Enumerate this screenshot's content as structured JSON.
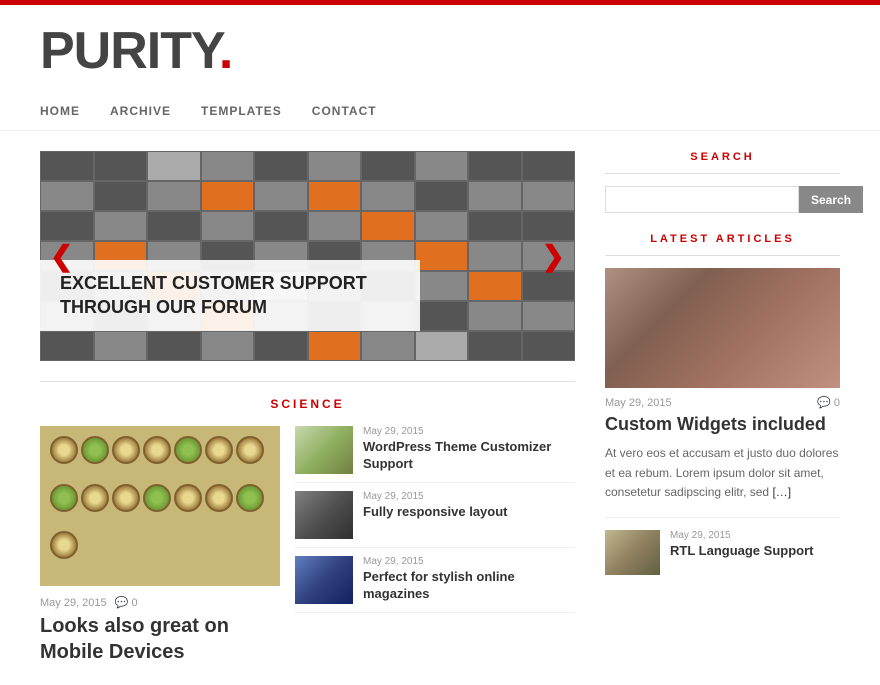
{
  "site": {
    "title": "PURITY",
    "dot": ".",
    "topbar_color": "#cc0000"
  },
  "nav": {
    "items": [
      {
        "label": "HOME",
        "href": "#"
      },
      {
        "label": "ARCHIVE",
        "href": "#"
      },
      {
        "label": "TEMPLATES",
        "href": "#"
      },
      {
        "label": "CONTACT",
        "href": "#"
      }
    ]
  },
  "slider": {
    "caption": "EXCELLENT CUSTOMER SUPPORT THROUGH OUR FORUM",
    "prev_arrow": "❮",
    "next_arrow": "❯"
  },
  "science_section": {
    "title": "SCIENCE"
  },
  "featured_article": {
    "date": "May 29, 2015",
    "comments": "0",
    "title": "Looks also great on Mobile Devices"
  },
  "article_list": [
    {
      "date": "May 29, 2015",
      "title": "WordPress Theme Customizer Support",
      "thumb_type": "plant"
    },
    {
      "date": "May 29, 2015",
      "title": "Fully responsive layout",
      "thumb_type": "dark"
    },
    {
      "date": "May 29, 2015",
      "title": "Perfect for stylish online magazines",
      "thumb_type": "blue"
    }
  ],
  "sidebar": {
    "search_title": "SEARCH",
    "search_placeholder": "",
    "search_button": "Search",
    "latest_title": "LATEST ARTICLES",
    "main_article": {
      "date": "May 29, 2015",
      "comments": "0",
      "title": "Custom Widgets included",
      "excerpt": "At vero eos et accusam et justo duo dolores et ea rebum. Lorem ipsum dolor sit amet, consetetur sadipscing elitr, sed",
      "read_more": "[…]"
    },
    "small_article": {
      "date": "May 29, 2015",
      "title": "RTL Language Support"
    }
  }
}
